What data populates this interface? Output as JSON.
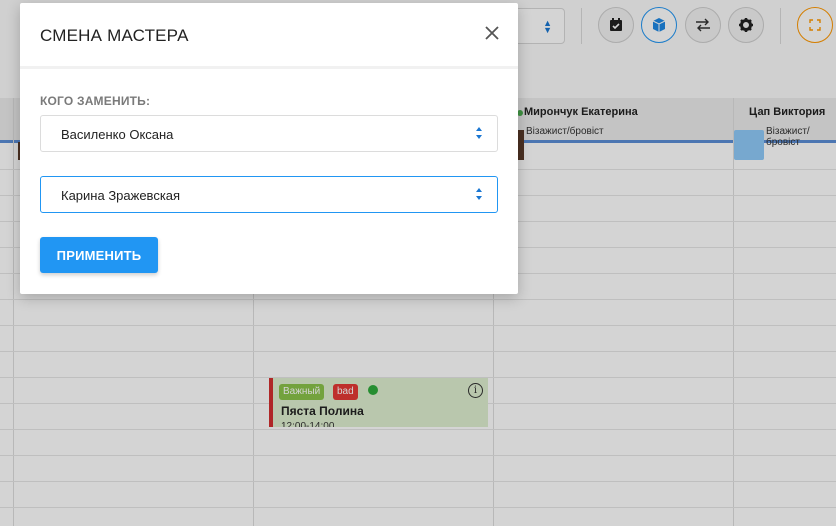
{
  "modal": {
    "title": "СМЕНА МАСТЕРА",
    "field_label": "КОГО ЗАМЕНИТЬ:",
    "replace_from": "Василенко Оксана",
    "replace_to": "Карина Зражевская",
    "apply_label": "ПРИМЕНИТЬ"
  },
  "schedule": {
    "staff": [
      {
        "name": "Мирончук Екатерина",
        "role": "Візажист/бровіст"
      },
      {
        "name": "Цап Виктория",
        "role": "Візажист/бровіст"
      }
    ],
    "appointment": {
      "tags": [
        "Важный",
        "bad"
      ],
      "client": "Пяста Полина",
      "time": "12:00-14:00"
    }
  },
  "colors": {
    "accent": "#2196f3",
    "appointment_bg": "#dff0d0",
    "appointment_border": "#d32f2f",
    "tag_green": "#8bc34a",
    "tag_red": "#e53935"
  },
  "icons": {
    "toolbar": [
      "calendar-check-icon",
      "cube-icon",
      "swap-arrows-icon",
      "gear-icon",
      "fullscreen-icon"
    ],
    "modal": [
      "close-icon",
      "select-arrows-icon"
    ]
  }
}
